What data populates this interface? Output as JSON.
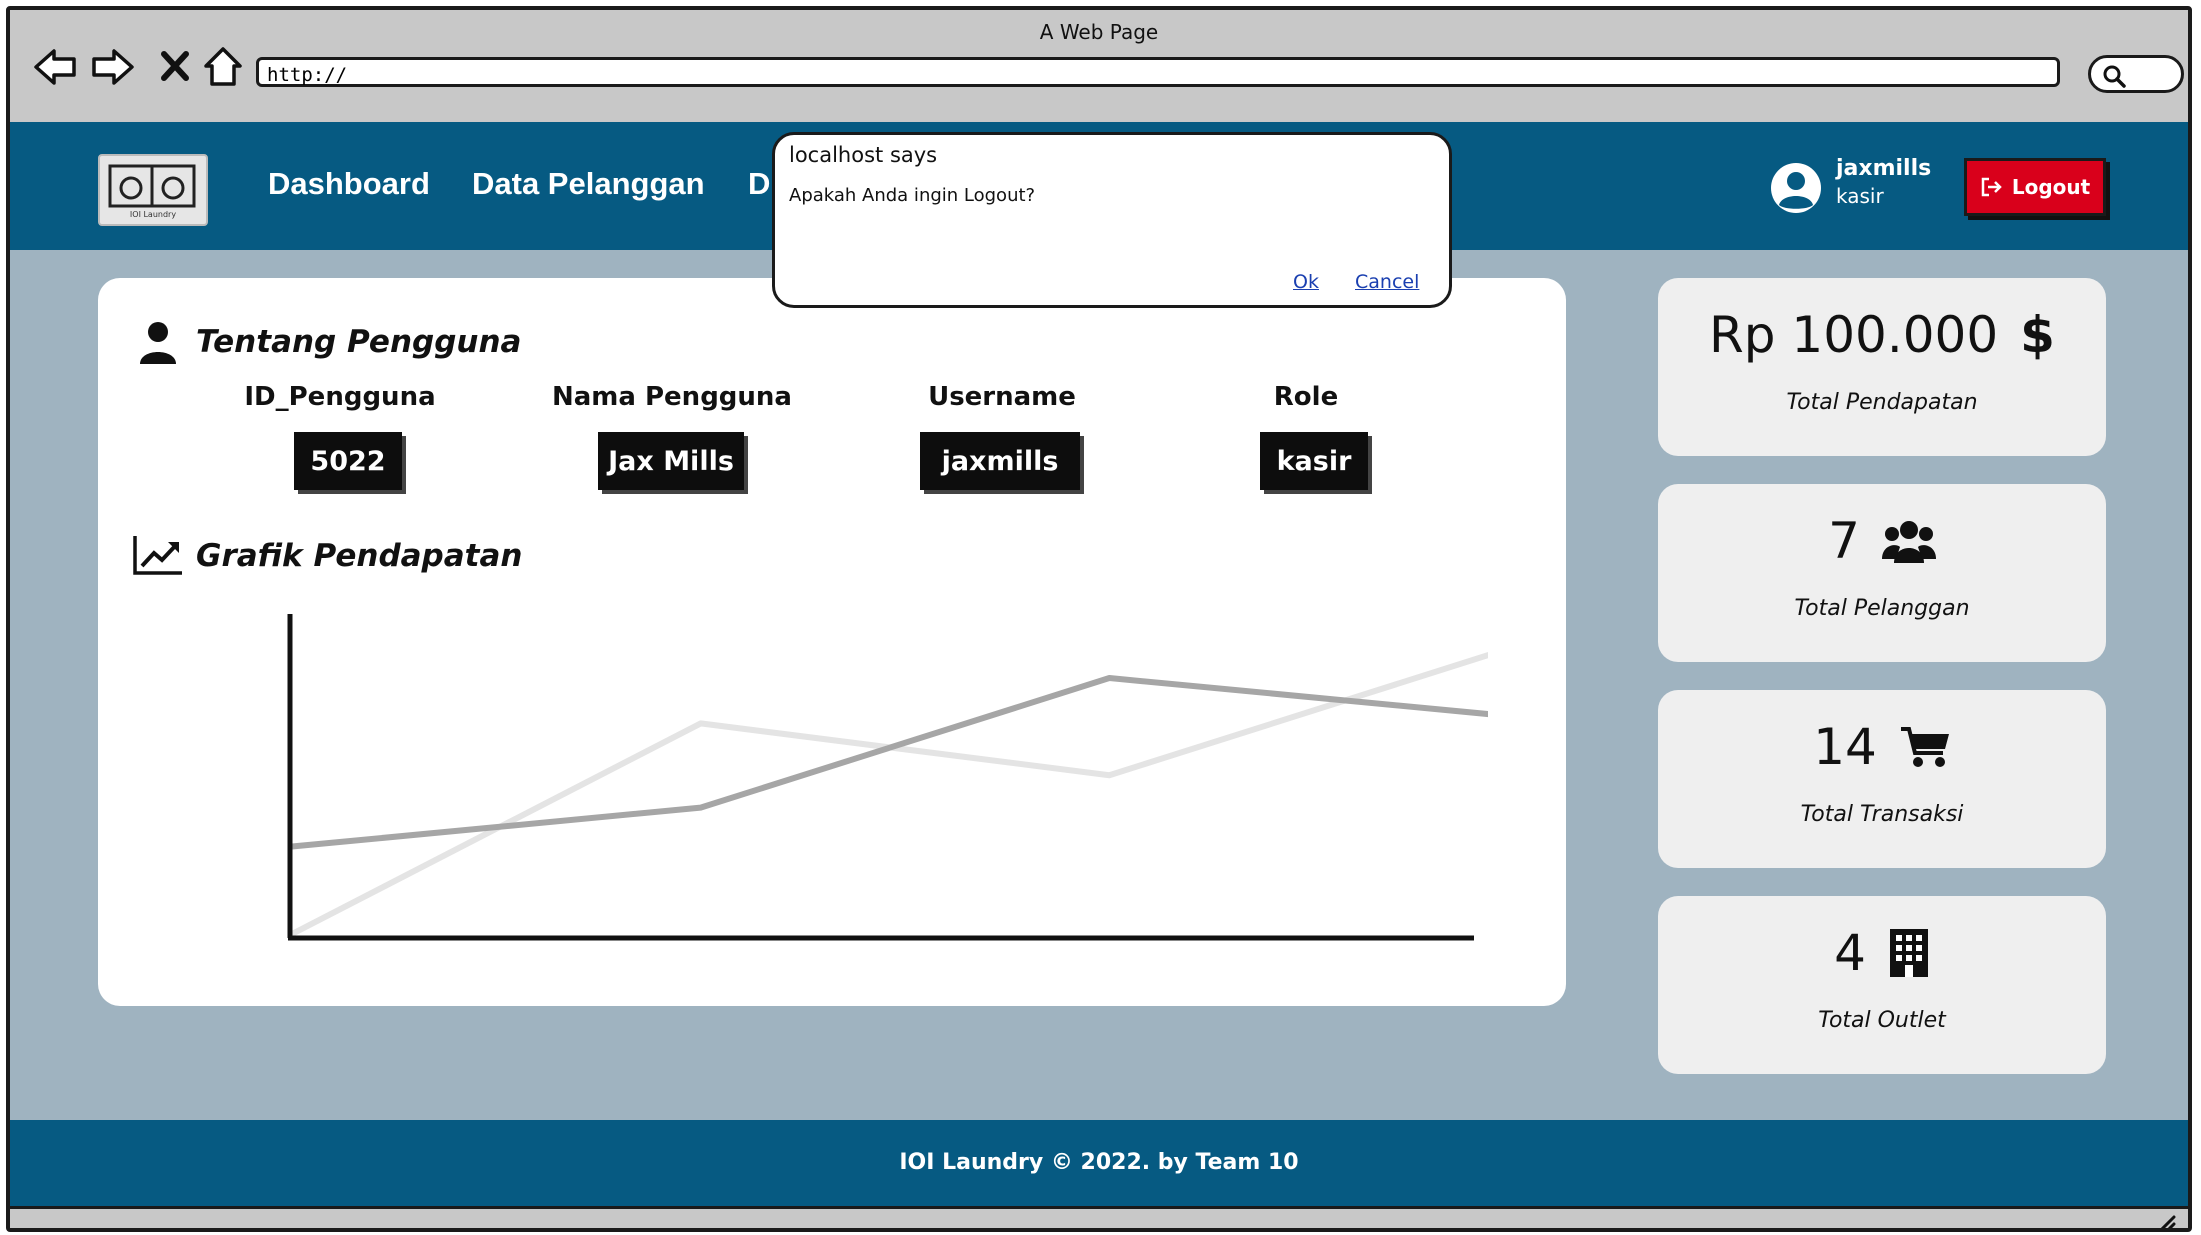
{
  "browser": {
    "window_title": "A Web Page",
    "address": "http://"
  },
  "header": {
    "logo_text": "IOI Laundry",
    "nav": [
      "Dashboard",
      "Data Pelanggan",
      "D"
    ],
    "user": {
      "name": "jaxmills",
      "role": "kasir"
    },
    "logout_label": "Logout",
    "logout_color": "#d9001b",
    "bg_color": "#065a82"
  },
  "profile": {
    "title": "Tentang Pengguna",
    "columns": [
      {
        "label": "ID_Pengguna",
        "value": "5022"
      },
      {
        "label": "Nama Pengguna",
        "value": "Jax Mills"
      },
      {
        "label": "Username",
        "value": "jaxmills"
      },
      {
        "label": "Role",
        "value": "kasir"
      }
    ]
  },
  "chart_section": {
    "title": "Grafik Pendapatan"
  },
  "chart_data": {
    "type": "line",
    "x": [
      0,
      1,
      2,
      3
    ],
    "ylim": [
      0,
      10
    ],
    "grid": false,
    "series": [
      {
        "color": "#e4e4e4",
        "values": [
          0,
          6.5,
          4.9,
          8.9
        ]
      },
      {
        "color": "#a6a6a6",
        "values": [
          2.7,
          3.9,
          7.9,
          6.7
        ]
      }
    ]
  },
  "stats": [
    {
      "value": "Rp 100.000",
      "icon": "dollar-icon",
      "label": "Total Pendapatan"
    },
    {
      "value": "7",
      "icon": "users-icon",
      "label": "Total Pelanggan"
    },
    {
      "value": "14",
      "icon": "cart-icon",
      "label": "Total Transaksi"
    },
    {
      "value": "4",
      "icon": "building-icon",
      "label": "Total Outlet"
    }
  ],
  "footer": {
    "text": "IOI Laundry © 2022. by Team 10"
  },
  "dialog": {
    "title": "localhost says",
    "message": "Apakah Anda ingin Logout?",
    "ok_label": "Ok",
    "cancel_label": "Cancel"
  }
}
